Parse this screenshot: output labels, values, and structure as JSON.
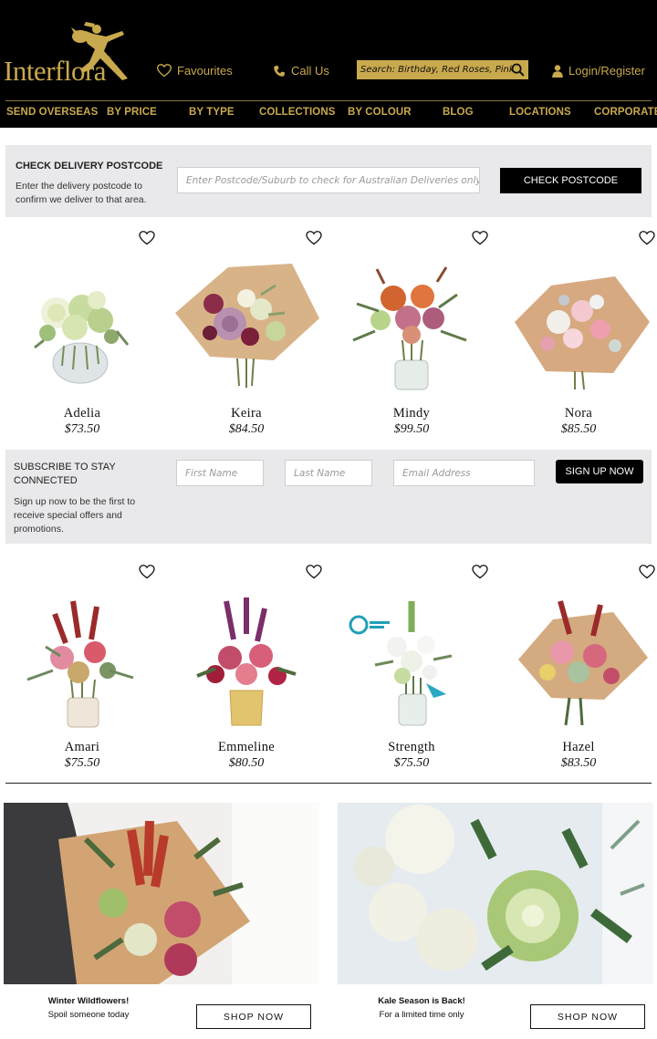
{
  "header": {
    "logo_text": "Interflora",
    "favourites_label": "Favourites",
    "call_label": "Call Us",
    "search_placeholder": "Search: Birthday, Red Roses, Pink Flowe",
    "login_label": "Login/Register"
  },
  "nav": {
    "items": [
      {
        "label": "SEND OVERSEAS"
      },
      {
        "label": "BY PRICE"
      },
      {
        "label": "BY TYPE"
      },
      {
        "label": "COLLECTIONS"
      },
      {
        "label": "BY COLOUR"
      },
      {
        "label": "BLOG"
      },
      {
        "label": "LOCATIONS"
      },
      {
        "label": "CORPORATE"
      }
    ]
  },
  "postcode": {
    "title": "CHECK DELIVERY POSTCODE",
    "description": "Enter the delivery postcode to confirm we deliver to that area.",
    "placeholder": "Enter Postcode/Suburb to check for Australian Deliveries only",
    "button_label": "CHECK POSTCODE"
  },
  "products_row1": [
    {
      "name": "Adelia",
      "price": "$73.50"
    },
    {
      "name": "Keira",
      "price": "$84.50"
    },
    {
      "name": "Mindy",
      "price": "$99.50"
    },
    {
      "name": "Nora",
      "price": "$85.50"
    }
  ],
  "subscribe": {
    "title": "SUBSCRIBE TO STAY CONNECTED",
    "description": "Sign up now to be the first to receive special offers and promotions.",
    "first_name_placeholder": "First Name",
    "last_name_placeholder": "Last Name",
    "email_placeholder": "Email Address",
    "button_label": "SIGN UP NOW"
  },
  "products_row2": [
    {
      "name": "Amari",
      "price": "$75.50"
    },
    {
      "name": "Emmeline",
      "price": "$80.50"
    },
    {
      "name": "Strength",
      "price": "$75.50"
    },
    {
      "name": "Hazel",
      "price": "$83.50"
    }
  ],
  "promos": [
    {
      "title": "Winter Wildflowers!",
      "subtitle": "Spoil someone today",
      "button_label": "SHOP NOW"
    },
    {
      "title": "Kale Season is Back!",
      "subtitle": "For a limited time only",
      "button_label": "SHOP NOW"
    }
  ],
  "colors": {
    "header_bg": "#000000",
    "gold": "#c9a94d",
    "panel_bg": "#e9e8ea"
  },
  "icons": [
    "heart-icon",
    "phone-icon",
    "user-icon",
    "search-icon",
    "logo-figure-icon"
  ]
}
